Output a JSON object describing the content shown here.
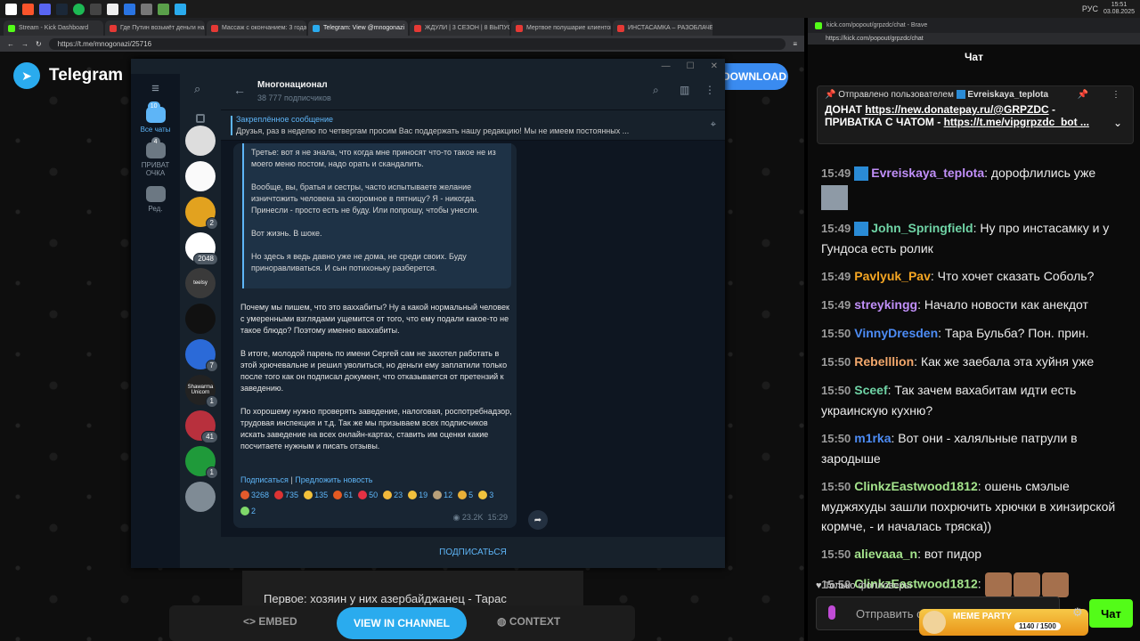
{
  "taskbar": {
    "lang": "РУС",
    "time": "15:51",
    "date": "03.08.2025"
  },
  "left_browser": {
    "tabs": [
      {
        "label": "Stream - Kick Dashboard",
        "active": false
      },
      {
        "label": "Где Путин возьмёт деньги на п",
        "active": false
      },
      {
        "label": "Массаж с окончанием: 3 года н",
        "active": false
      },
      {
        "label": "Telegram: View @mnogonazi",
        "active": true
      },
      {
        "label": "ЖДУЛИ | 3 СЕЗОН | 8 ВЫПУСК -",
        "active": false
      },
      {
        "label": "Мертвое полушарие клиентов",
        "active": false
      },
      {
        "label": "ИНСТАСАМКА – РАЗОБЛАЧЕНИ",
        "active": false
      }
    ],
    "url": "https://t.me/mnogonazi/25716"
  },
  "web": {
    "brand": "Telegram",
    "download": "DOWNLOAD",
    "behind_text": "Первое: хозяин у них азербайджанец - Тарас",
    "embed": "EMBED",
    "view_channel": "VIEW IN CHANNEL",
    "context": "CONTEXT"
  },
  "tg": {
    "folders": [
      {
        "label": "Все чаты",
        "badge": "10",
        "active": true
      },
      {
        "label": "ПРИВАТ ОЧКА",
        "badge": "4",
        "active": false
      },
      {
        "label": "Ред.",
        "badge": "",
        "active": false
      }
    ],
    "avatars": [
      {
        "badge": "",
        "color": "#ddd"
      },
      {
        "badge": "",
        "color": "#fafafa"
      },
      {
        "badge": "2",
        "color": "#e2a21f"
      },
      {
        "badge": "2048",
        "color": "#fff"
      },
      {
        "badge": "",
        "color": "#3a3a3a",
        "text": "teelsy"
      },
      {
        "badge": "",
        "color": "#111"
      },
      {
        "badge": "7",
        "color": "#2b6ad8"
      },
      {
        "badge": "1",
        "color": "#222",
        "text": "Shawarma Unicorn"
      },
      {
        "badge": "41",
        "color": "#b8303d"
      },
      {
        "badge": "1",
        "color": "#1f9a3a"
      },
      {
        "badge": "",
        "color": "#7f8b95"
      }
    ],
    "chat_title": "Многонационал",
    "subscribers": "38 777 подписчиков",
    "pinned_label": "Закреплённое сообщение",
    "pinned_text": "Друзья, раз в неделю по четвергам просим Вас поддержать нашу редакцию!   Мы не имеем постоянных ...",
    "quote_paragraphs": [
      "Третье: вот я не знала, что когда мне приносят что-то такое не из моего меню постом, надо орать и скандалить.",
      "Вообще, вы, братья и сестры, часто испытываете желание изничтожить человека за скоромное в пятницу? Я - никогда. Принесли - просто есть не буду. Или попрошу, чтобы унесли.",
      "Вот жизнь. В шоке.",
      "Но здесь я ведь давно уже не дома, не среди своих. Буду приноравливаться. И сын потихоньку разберется."
    ],
    "body_paragraphs": [
      "Почему мы пишем, что это ваххабиты? Ну а какой нормальный человек с умеренными взглядами ущемится от того, что ему подали какое-то не такое блюдо? Поэтому именно ваххабиты.",
      "В итоге, молодой парень по имени Сергей сам не захотел работать в этой хрючевальне и решил уволиться, но деньги ему заплатили только после того как он подписал документ, что отказывается от претензий к заведению.",
      "По хорошему нужно проверять заведение, налоговая, роспотребнадзор, трудовая инспекция и т.д. Так же мы призываем всех подписчиков искать заведение на всех онлайн-картах, ставить им оценки какие посчитаете нужным и писать отзывы."
    ],
    "link_subscribe": "Подписаться",
    "link_separator": "|",
    "link_suggest": "Предложить новость",
    "reactions": [
      {
        "emoji": "angry-face",
        "count": "3268",
        "color": "#e25a2c"
      },
      {
        "emoji": "hundred",
        "count": "735",
        "color": "#d33"
      },
      {
        "emoji": "laughing-face",
        "count": "135",
        "color": "#f3c13a"
      },
      {
        "emoji": "rage-face",
        "count": "61",
        "color": "#e55a22"
      },
      {
        "emoji": "heart",
        "count": "50",
        "color": "#e53144"
      },
      {
        "emoji": "thumbs-up",
        "count": "23",
        "color": "#f2b93b"
      },
      {
        "emoji": "scream-face",
        "count": "19",
        "color": "#f2c03d"
      },
      {
        "emoji": "vomit-face",
        "count": "12",
        "color": "#b7a07a"
      },
      {
        "emoji": "clown",
        "count": "5",
        "color": "#e9b038"
      },
      {
        "emoji": "smile-face",
        "count": "3",
        "color": "#f1c33d"
      },
      {
        "emoji": "confetti",
        "count": "2",
        "color": "#7fd86a"
      }
    ],
    "views": "23.2K",
    "time": "15:29",
    "subscribe_button": "ПОДПИСАТЬСЯ"
  },
  "right_browser": {
    "title": "kick.com/popout/grpzdc/chat - Brave",
    "url": "https://kick.com/popout/grpzdc/chat",
    "header": "Чат",
    "pinned_from_label": "Отправлено пользователем",
    "pinned_from_user": "Evreiskaya_teplota",
    "pinned_line1_prefix": "ДОНАТ",
    "pinned_link1": "https://new.donatepay.ru/@GRPZDC",
    "pinned_line1_suffix": "-",
    "pinned_line2_prefix": "ПРИВАТКА С ЧАТОМ -",
    "pinned_link2": "https://t.me/vipgrpzdc_bot ...",
    "messages": [
      {
        "time": "15:49",
        "user": "Evreiskaya_teplota",
        "color": "#c08ff8",
        "text": "дорофлились уже",
        "badge": true
      },
      {
        "time": "15:49",
        "user": "John_Springfield",
        "color": "#6fd3a5",
        "text": "Ну про инстасамку и у Гундоса есть ролик",
        "badge": true
      },
      {
        "time": "15:49",
        "user": "Pavlyuk_Pav",
        "color": "#f5a623",
        "text": "Что хочет сказать Соболь?"
      },
      {
        "time": "15:49",
        "user": "streykingg",
        "color": "#c08ff8",
        "text": "Начало новости как анекдот"
      },
      {
        "time": "15:50",
        "user": "VinnyDresden",
        "color": "#4d8cf5",
        "text": "Тара Бульба? Пон. прин."
      },
      {
        "time": "15:50",
        "user": "Rebelllion",
        "color": "#f3a86c",
        "text": "Как же заебала эта хуйня уже"
      },
      {
        "time": "15:50",
        "user": "Sceef",
        "color": "#6fd3a5",
        "text": "Так зачем вахабитам идти есть украинскую кухню?"
      },
      {
        "time": "15:50",
        "user": "m1rka",
        "color": "#4d8cf5",
        "text": "Вот они - халяльные патрули в зародыше"
      },
      {
        "time": "15:50",
        "user": "ClinkzEastwood1812",
        "color": "#a4e38c",
        "text": "ошень смэлые муджяхуды зашли похрючить хрючки в хинзирской кормче, - и началась тряска))"
      },
      {
        "time": "15:50",
        "user": "alievaaa_n",
        "color": "#a4e38c",
        "text": "вот пидор"
      },
      {
        "time": "15:50",
        "user": "ClinkzEastwood1812",
        "color": "#a4e38c",
        "text": "",
        "emotes": 3
      }
    ],
    "followers_only": "Только фолловеры",
    "input_placeholder": "Отправить со",
    "chat_button": "Чат",
    "meme_title": "MEME PARTY",
    "meme_count": "1140 / 1500"
  }
}
